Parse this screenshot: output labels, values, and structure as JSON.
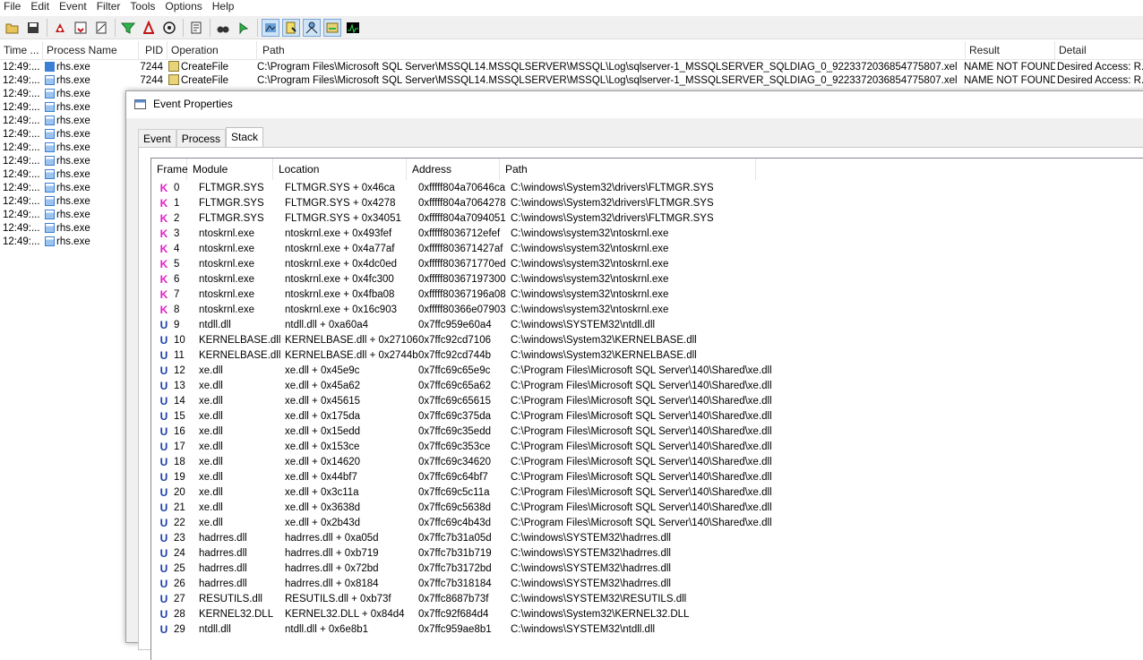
{
  "menu": [
    "File",
    "Edit",
    "Event",
    "Filter",
    "Tools",
    "Options",
    "Help"
  ],
  "toolbar": {
    "icons": [
      "open-icon",
      "save-icon",
      "capture-icon",
      "autoscroll-icon",
      "clear-icon",
      "filter-icon",
      "highlight-icon",
      "target-icon",
      "tree-icon",
      "find-icon",
      "jump-icon",
      "registry-icon",
      "filesystem-icon",
      "network-icon",
      "process-icon",
      "profiling-icon"
    ]
  },
  "list": {
    "columns": [
      "Time ...",
      "Process Name",
      "PID",
      "Operation",
      "Path",
      "Result",
      "Detail"
    ],
    "rows": [
      {
        "time": "12:49:...",
        "process": "rhs.exe",
        "pid": "7244",
        "operation": "CreateFile",
        "path": "C:\\Program Files\\Microsoft SQL Server\\MSSQL14.MSSQLSERVER\\MSSQL\\Log\\sqlserver-1_MSSQLSERVER_SQLDIAG_0_9223372036854775807.xel",
        "result": "NAME NOT FOUND",
        "detail": "Desired Access: R..."
      },
      {
        "time": "12:49:...",
        "process": "rhs.exe",
        "pid": "7244",
        "operation": "CreateFile",
        "path": "C:\\Program Files\\Microsoft SQL Server\\MSSQL14.MSSQLSERVER\\MSSQL\\Log\\sqlserver-1_MSSQLSERVER_SQLDIAG_0_9223372036854775807.xel",
        "result": "NAME NOT FOUND",
        "detail": "Desired Access: R..."
      },
      {
        "time": "12:49:...",
        "process": "rhs.exe"
      },
      {
        "time": "12:49:...",
        "process": "rhs.exe"
      },
      {
        "time": "12:49:...",
        "process": "rhs.exe"
      },
      {
        "time": "12:49:...",
        "process": "rhs.exe"
      },
      {
        "time": "12:49:...",
        "process": "rhs.exe"
      },
      {
        "time": "12:49:...",
        "process": "rhs.exe"
      },
      {
        "time": "12:49:...",
        "process": "rhs.exe"
      },
      {
        "time": "12:49:...",
        "process": "rhs.exe"
      },
      {
        "time": "12:49:...",
        "process": "rhs.exe"
      },
      {
        "time": "12:49:...",
        "process": "rhs.exe"
      },
      {
        "time": "12:49:...",
        "process": "rhs.exe"
      },
      {
        "time": "12:49:...",
        "process": "rhs.exe"
      }
    ]
  },
  "dialog": {
    "title": "Event Properties",
    "tabs": [
      "Event",
      "Process",
      "Stack"
    ],
    "active_tab": "Stack",
    "stack": {
      "columns": [
        "Frame",
        "Module",
        "Location",
        "Address",
        "Path"
      ],
      "rows": [
        {
          "mode": "K",
          "frame": "0",
          "module": "FLTMGR.SYS",
          "location": "FLTMGR.SYS + 0x46ca",
          "address": "0xfffff804a70646ca",
          "path": "C:\\windows\\System32\\drivers\\FLTMGR.SYS"
        },
        {
          "mode": "K",
          "frame": "1",
          "module": "FLTMGR.SYS",
          "location": "FLTMGR.SYS + 0x4278",
          "address": "0xfffff804a7064278",
          "path": "C:\\windows\\System32\\drivers\\FLTMGR.SYS"
        },
        {
          "mode": "K",
          "frame": "2",
          "module": "FLTMGR.SYS",
          "location": "FLTMGR.SYS + 0x34051",
          "address": "0xfffff804a7094051",
          "path": "C:\\windows\\System32\\drivers\\FLTMGR.SYS"
        },
        {
          "mode": "K",
          "frame": "3",
          "module": "ntoskrnl.exe",
          "location": "ntoskrnl.exe + 0x493fef",
          "address": "0xfffff8036712efef",
          "path": "C:\\windows\\system32\\ntoskrnl.exe"
        },
        {
          "mode": "K",
          "frame": "4",
          "module": "ntoskrnl.exe",
          "location": "ntoskrnl.exe + 0x4a77af",
          "address": "0xfffff803671427af",
          "path": "C:\\windows\\system32\\ntoskrnl.exe"
        },
        {
          "mode": "K",
          "frame": "5",
          "module": "ntoskrnl.exe",
          "location": "ntoskrnl.exe + 0x4dc0ed",
          "address": "0xfffff803671770ed",
          "path": "C:\\windows\\system32\\ntoskrnl.exe"
        },
        {
          "mode": "K",
          "frame": "6",
          "module": "ntoskrnl.exe",
          "location": "ntoskrnl.exe + 0x4fc300",
          "address": "0xfffff80367197300",
          "path": "C:\\windows\\system32\\ntoskrnl.exe"
        },
        {
          "mode": "K",
          "frame": "7",
          "module": "ntoskrnl.exe",
          "location": "ntoskrnl.exe + 0x4fba08",
          "address": "0xfffff80367196a08",
          "path": "C:\\windows\\system32\\ntoskrnl.exe"
        },
        {
          "mode": "K",
          "frame": "8",
          "module": "ntoskrnl.exe",
          "location": "ntoskrnl.exe + 0x16c903",
          "address": "0xfffff80366e07903",
          "path": "C:\\windows\\system32\\ntoskrnl.exe"
        },
        {
          "mode": "U",
          "frame": "9",
          "module": "ntdll.dll",
          "location": "ntdll.dll + 0xa60a4",
          "address": "0x7ffc959e60a4",
          "path": "C:\\windows\\SYSTEM32\\ntdll.dll"
        },
        {
          "mode": "U",
          "frame": "10",
          "module": "KERNELBASE.dll",
          "location": "KERNELBASE.dll + 0x27106",
          "address": "0x7ffc92cd7106",
          "path": "C:\\windows\\System32\\KERNELBASE.dll"
        },
        {
          "mode": "U",
          "frame": "11",
          "module": "KERNELBASE.dll",
          "location": "KERNELBASE.dll + 0x2744b",
          "address": "0x7ffc92cd744b",
          "path": "C:\\windows\\System32\\KERNELBASE.dll"
        },
        {
          "mode": "U",
          "frame": "12",
          "module": "xe.dll",
          "location": "xe.dll + 0x45e9c",
          "address": "0x7ffc69c65e9c",
          "path": "C:\\Program Files\\Microsoft SQL Server\\140\\Shared\\xe.dll"
        },
        {
          "mode": "U",
          "frame": "13",
          "module": "xe.dll",
          "location": "xe.dll + 0x45a62",
          "address": "0x7ffc69c65a62",
          "path": "C:\\Program Files\\Microsoft SQL Server\\140\\Shared\\xe.dll"
        },
        {
          "mode": "U",
          "frame": "14",
          "module": "xe.dll",
          "location": "xe.dll + 0x45615",
          "address": "0x7ffc69c65615",
          "path": "C:\\Program Files\\Microsoft SQL Server\\140\\Shared\\xe.dll"
        },
        {
          "mode": "U",
          "frame": "15",
          "module": "xe.dll",
          "location": "xe.dll + 0x175da",
          "address": "0x7ffc69c375da",
          "path": "C:\\Program Files\\Microsoft SQL Server\\140\\Shared\\xe.dll"
        },
        {
          "mode": "U",
          "frame": "16",
          "module": "xe.dll",
          "location": "xe.dll + 0x15edd",
          "address": "0x7ffc69c35edd",
          "path": "C:\\Program Files\\Microsoft SQL Server\\140\\Shared\\xe.dll"
        },
        {
          "mode": "U",
          "frame": "17",
          "module": "xe.dll",
          "location": "xe.dll + 0x153ce",
          "address": "0x7ffc69c353ce",
          "path": "C:\\Program Files\\Microsoft SQL Server\\140\\Shared\\xe.dll"
        },
        {
          "mode": "U",
          "frame": "18",
          "module": "xe.dll",
          "location": "xe.dll + 0x14620",
          "address": "0x7ffc69c34620",
          "path": "C:\\Program Files\\Microsoft SQL Server\\140\\Shared\\xe.dll"
        },
        {
          "mode": "U",
          "frame": "19",
          "module": "xe.dll",
          "location": "xe.dll + 0x44bf7",
          "address": "0x7ffc69c64bf7",
          "path": "C:\\Program Files\\Microsoft SQL Server\\140\\Shared\\xe.dll"
        },
        {
          "mode": "U",
          "frame": "20",
          "module": "xe.dll",
          "location": "xe.dll + 0x3c11a",
          "address": "0x7ffc69c5c11a",
          "path": "C:\\Program Files\\Microsoft SQL Server\\140\\Shared\\xe.dll"
        },
        {
          "mode": "U",
          "frame": "21",
          "module": "xe.dll",
          "location": "xe.dll + 0x3638d",
          "address": "0x7ffc69c5638d",
          "path": "C:\\Program Files\\Microsoft SQL Server\\140\\Shared\\xe.dll"
        },
        {
          "mode": "U",
          "frame": "22",
          "module": "xe.dll",
          "location": "xe.dll + 0x2b43d",
          "address": "0x7ffc69c4b43d",
          "path": "C:\\Program Files\\Microsoft SQL Server\\140\\Shared\\xe.dll"
        },
        {
          "mode": "U",
          "frame": "23",
          "module": "hadrres.dll",
          "location": "hadrres.dll + 0xa05d",
          "address": "0x7ffc7b31a05d",
          "path": "C:\\windows\\SYSTEM32\\hadrres.dll"
        },
        {
          "mode": "U",
          "frame": "24",
          "module": "hadrres.dll",
          "location": "hadrres.dll + 0xb719",
          "address": "0x7ffc7b31b719",
          "path": "C:\\windows\\SYSTEM32\\hadrres.dll"
        },
        {
          "mode": "U",
          "frame": "25",
          "module": "hadrres.dll",
          "location": "hadrres.dll + 0x72bd",
          "address": "0x7ffc7b3172bd",
          "path": "C:\\windows\\SYSTEM32\\hadrres.dll"
        },
        {
          "mode": "U",
          "frame": "26",
          "module": "hadrres.dll",
          "location": "hadrres.dll + 0x8184",
          "address": "0x7ffc7b318184",
          "path": "C:\\windows\\SYSTEM32\\hadrres.dll"
        },
        {
          "mode": "U",
          "frame": "27",
          "module": "RESUTILS.dll",
          "location": "RESUTILS.dll + 0xb73f",
          "address": "0x7ffc8687b73f",
          "path": "C:\\windows\\SYSTEM32\\RESUTILS.dll"
        },
        {
          "mode": "U",
          "frame": "28",
          "module": "KERNEL32.DLL",
          "location": "KERNEL32.DLL + 0x84d4",
          "address": "0x7ffc92f684d4",
          "path": "C:\\windows\\System32\\KERNEL32.DLL"
        },
        {
          "mode": "U",
          "frame": "29",
          "module": "ntdll.dll",
          "location": "ntdll.dll + 0x6e8b1",
          "address": "0x7ffc959ae8b1",
          "path": "C:\\windows\\SYSTEM32\\ntdll.dll"
        }
      ]
    }
  },
  "colors": {
    "kernel": "#e020c8",
    "user": "#1b3fa8",
    "selection": "#cce8ff"
  }
}
